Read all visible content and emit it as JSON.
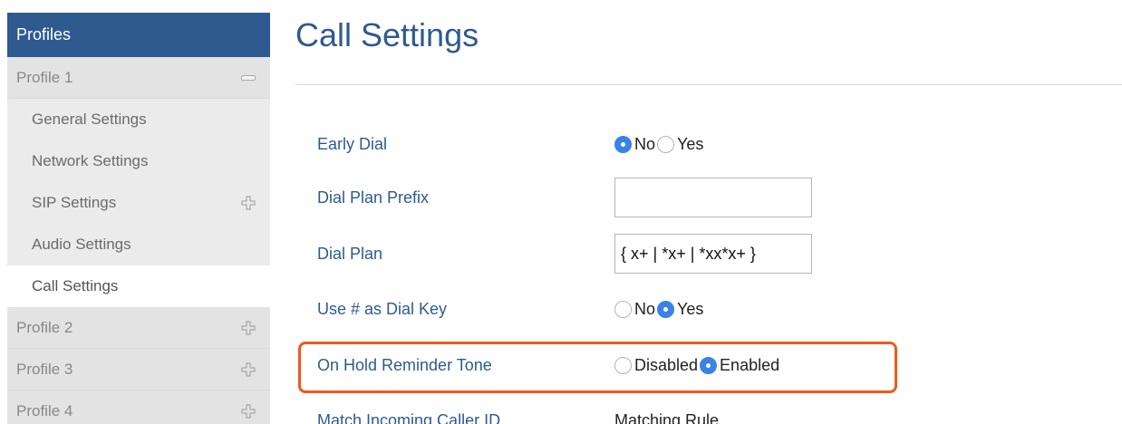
{
  "sidebar": {
    "header": "Profiles",
    "profile1": {
      "label": "Profile 1",
      "icon": "minus-icon"
    },
    "subitems": [
      {
        "label": "General Settings"
      },
      {
        "label": "Network Settings"
      },
      {
        "label": "SIP Settings",
        "icon": "plus-icon"
      },
      {
        "label": "Audio Settings"
      },
      {
        "label": "Call Settings",
        "active": true
      }
    ],
    "profiles": [
      {
        "label": "Profile 2",
        "icon": "plus-icon"
      },
      {
        "label": "Profile 3",
        "icon": "plus-icon"
      },
      {
        "label": "Profile 4",
        "icon": "plus-icon"
      }
    ]
  },
  "main": {
    "title": "Call Settings",
    "early_dial": {
      "label": "Early Dial",
      "options": [
        "No",
        "Yes"
      ],
      "selected": "No"
    },
    "dial_plan_prefix": {
      "label": "Dial Plan Prefix",
      "value": ""
    },
    "dial_plan": {
      "label": "Dial Plan",
      "value": "{ x+ | *x+ | *xx*x+ }"
    },
    "use_hash": {
      "label": "Use # as Dial Key",
      "options": [
        "No",
        "Yes"
      ],
      "selected": "Yes"
    },
    "on_hold": {
      "label": "On Hold Reminder Tone",
      "options": [
        "Disabled",
        "Enabled"
      ],
      "selected": "Enabled"
    },
    "match_caller": {
      "label": "Match Incoming Caller ID",
      "value": "Matching Rule"
    }
  },
  "colors": {
    "accent": "#2f5a8f",
    "radio_checked": "#3a82e6",
    "highlight": "#f05a1c"
  }
}
